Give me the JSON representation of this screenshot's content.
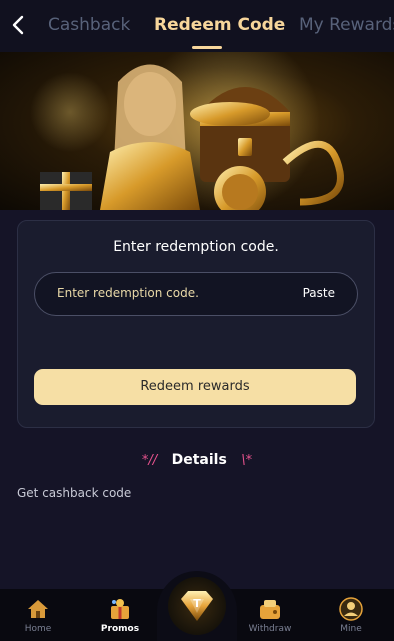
{
  "header": {
    "tabs": [
      {
        "label": "Cashback"
      },
      {
        "label": "Redeem Code"
      },
      {
        "label": "My Rewards"
      }
    ],
    "active_tab": "Redeem Code"
  },
  "redeem_card": {
    "title": "Enter redemption code.",
    "input_placeholder": "Enter redemption code.",
    "paste_label": "Paste",
    "redeem_button_label": "Redeem rewards"
  },
  "details": {
    "left_deco": "*//",
    "title": "Details",
    "right_deco": "\\*",
    "text": "Get cashback code"
  },
  "bottom_nav": {
    "items": [
      {
        "label": "Home",
        "icon": "home-icon"
      },
      {
        "label": "Promos",
        "icon": "gift-icon",
        "active": true
      },
      {
        "label": "",
        "icon": "diamond-logo-icon"
      },
      {
        "label": "Withdraw",
        "icon": "wallet-icon"
      },
      {
        "label": "Mine",
        "icon": "user-icon"
      }
    ]
  },
  "colors": {
    "accent_gold": "#f7d69b",
    "button_bg": "#f6dfa5",
    "page_bg": "#151427",
    "card_bg": "#1a1c2e",
    "details_deco": "#e8538e"
  }
}
